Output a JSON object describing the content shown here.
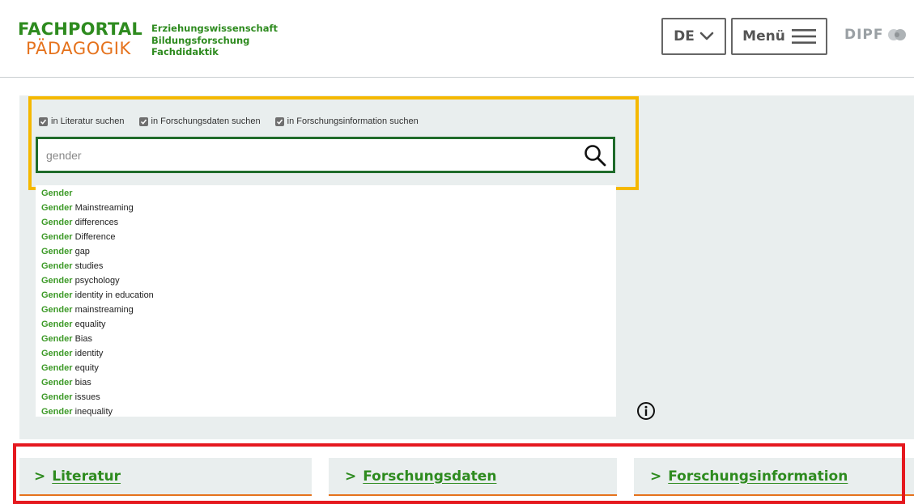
{
  "header": {
    "logo_line1": "FACHPORTAL",
    "logo_line2": "PÄDAGOGIK",
    "logo_sub": [
      "Erziehungswissenschaft",
      "Bildungsforschung",
      "Fachdidaktik"
    ],
    "lang_label": "DE",
    "menu_label": "Menü",
    "dipf_label": "DIPF"
  },
  "search": {
    "options": [
      {
        "label": "in Literatur suchen",
        "checked": true
      },
      {
        "label": "in Forschungsdaten suchen",
        "checked": true
      },
      {
        "label": "in Forschungsinformation suchen",
        "checked": true
      }
    ],
    "query": "gender",
    "suggestions": [
      {
        "bold": "Gender",
        "rest": ""
      },
      {
        "bold": "Gender",
        "rest": " Mainstreaming"
      },
      {
        "bold": "Gender",
        "rest": " differences"
      },
      {
        "bold": "Gender",
        "rest": " Difference"
      },
      {
        "bold": "Gender",
        "rest": " gap"
      },
      {
        "bold": "Gender",
        "rest": " studies"
      },
      {
        "bold": "Gender",
        "rest": " psychology"
      },
      {
        "bold": "Gender",
        "rest": " identity in education"
      },
      {
        "bold": "Gender",
        "rest": " mainstreaming"
      },
      {
        "bold": "Gender",
        "rest": " equality"
      },
      {
        "bold": "Gender",
        "rest": " Bias"
      },
      {
        "bold": "Gender",
        "rest": " identity"
      },
      {
        "bold": "Gender",
        "rest": " equity"
      },
      {
        "bold": "Gender",
        "rest": " bias"
      },
      {
        "bold": "Gender",
        "rest": " issues"
      },
      {
        "bold": "Gender",
        "rest": " inequality"
      }
    ]
  },
  "tabs": [
    {
      "label": "Literatur"
    },
    {
      "label": "Forschungsdaten"
    },
    {
      "label": "Forschungsinformation"
    }
  ],
  "colors": {
    "brand_green": "#2e8b1f",
    "brand_orange": "#e5721c",
    "search_border": "#1f6b2a",
    "highlight_yellow": "#f5b800",
    "highlight_red": "#e5191f",
    "panel_bg": "#e9eeee"
  }
}
